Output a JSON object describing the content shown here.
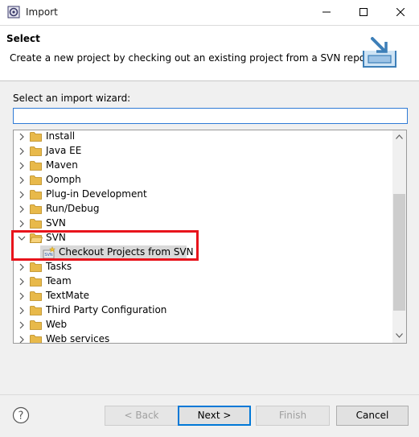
{
  "window": {
    "title": "Import",
    "app_icon": "eclipse-icon",
    "controls": [
      "minimize-icon",
      "maximize-icon",
      "close-icon"
    ]
  },
  "banner": {
    "title": "Select",
    "description": "Create a new project by checking out an existing project from a SVN repository.",
    "icon": "import-wizard-icon"
  },
  "wizard": {
    "prompt": "Select an import wizard:",
    "filter_value": "",
    "tree": [
      {
        "label": "Install",
        "expanded": false
      },
      {
        "label": "Java EE",
        "expanded": false
      },
      {
        "label": "Maven",
        "expanded": false
      },
      {
        "label": "Oomph",
        "expanded": false
      },
      {
        "label": "Plug-in Development",
        "expanded": false
      },
      {
        "label": "Run/Debug",
        "expanded": false
      },
      {
        "label": "SVN",
        "expanded": false
      },
      {
        "label": "SVN",
        "expanded": true,
        "children": [
          {
            "label": "Checkout Projects from SVN",
            "icon": "svn-checkout-icon",
            "selected": true
          }
        ]
      },
      {
        "label": "Tasks",
        "expanded": false
      },
      {
        "label": "Team",
        "expanded": false
      },
      {
        "label": "TextMate",
        "expanded": false
      },
      {
        "label": "Third Party Configuration",
        "expanded": false
      },
      {
        "label": "Web",
        "expanded": false
      },
      {
        "label": "Web services",
        "expanded": false
      }
    ]
  },
  "buttons": {
    "help_icon": "help-icon",
    "back": "< Back",
    "next": "Next >",
    "finish": "Finish",
    "cancel": "Cancel"
  },
  "colors": {
    "highlight_border": "#e8141c",
    "focus_accent": "#0078d7",
    "folder": "#e8b94a"
  }
}
